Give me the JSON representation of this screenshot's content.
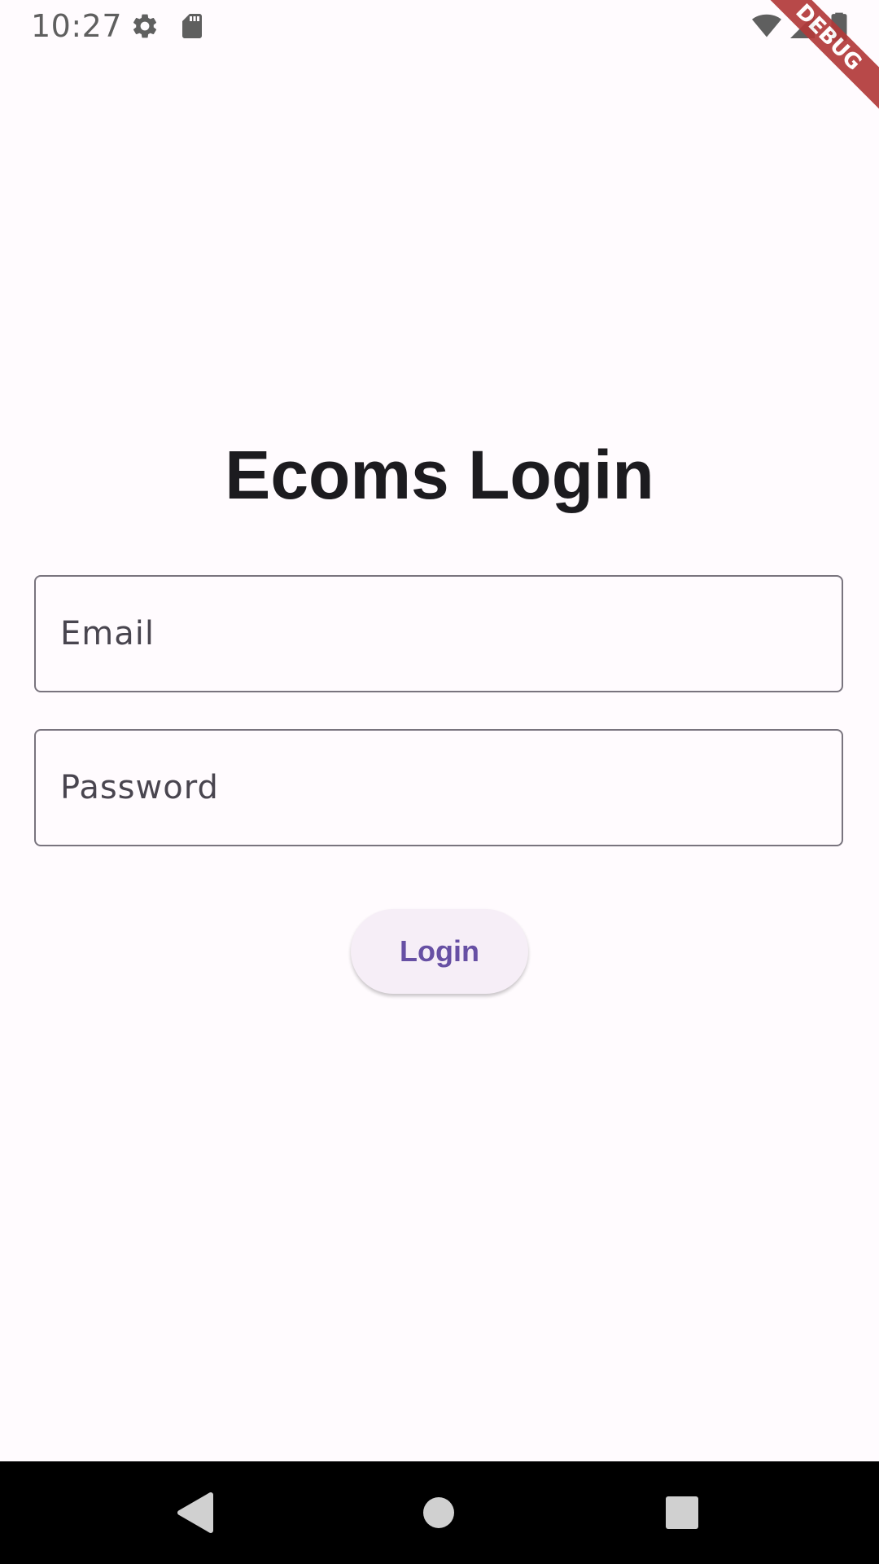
{
  "status_bar": {
    "time": "10:27",
    "icons": [
      "settings-icon",
      "sd-card-icon",
      "wifi-icon",
      "signal-icon",
      "battery-icon"
    ]
  },
  "debug_banner": {
    "label": "DEBUG",
    "color": "#b23a3a"
  },
  "login": {
    "title": "Ecoms Login",
    "email_placeholder": "Email",
    "email_value": "",
    "password_placeholder": "Password",
    "password_value": "",
    "button_label": "Login"
  },
  "navigation": {
    "buttons": [
      "back-icon",
      "home-icon",
      "recents-icon"
    ]
  },
  "colors": {
    "background": "#fffbfe",
    "title": "#1c1b1f",
    "field_border": "#79747e",
    "button_bg": "#f6eef7",
    "button_text": "#6750a4"
  }
}
